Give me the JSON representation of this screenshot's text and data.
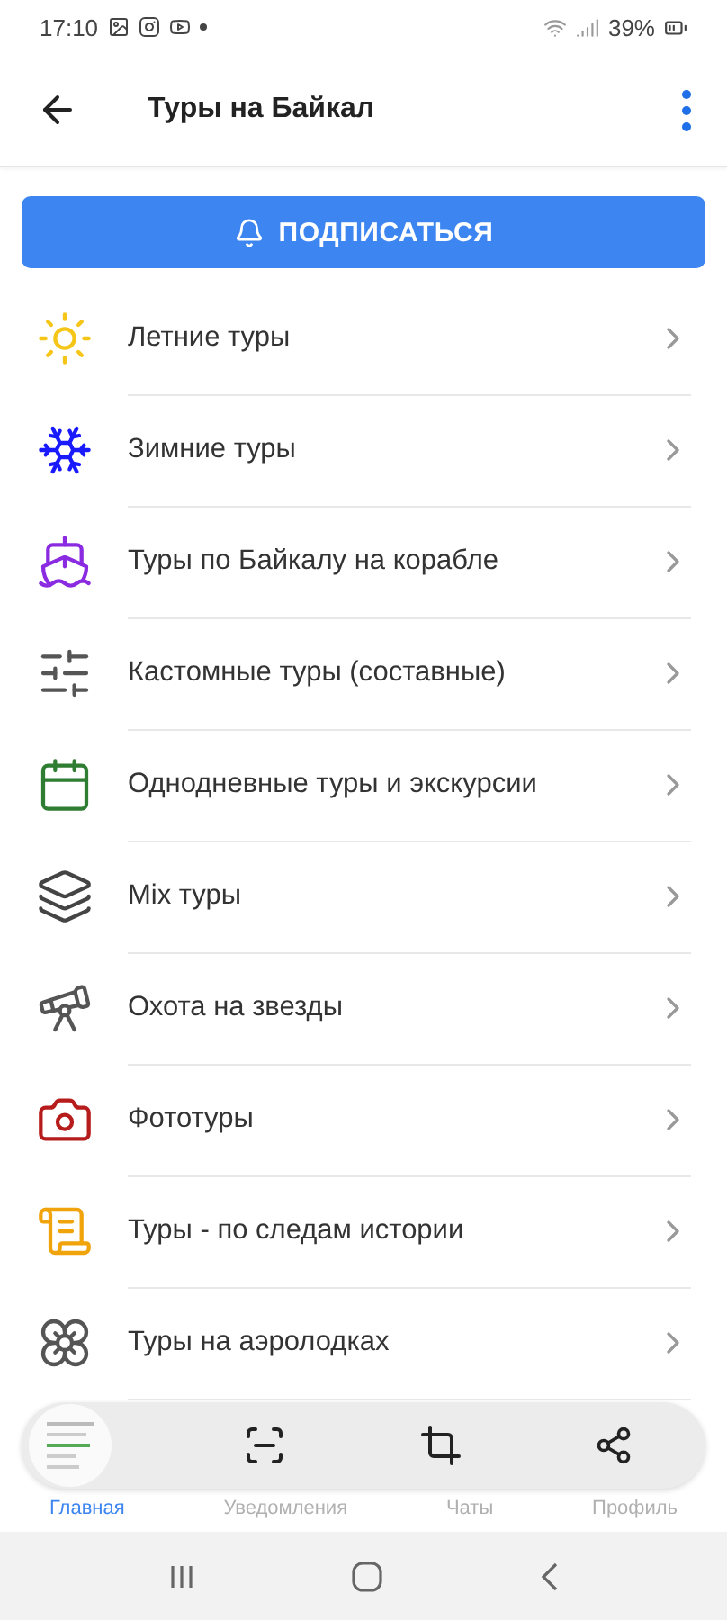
{
  "status_bar": {
    "time": "17:10",
    "battery": "39%"
  },
  "app_bar": {
    "title": "Туры на Байкал"
  },
  "subscribe_button": {
    "label": "ПОДПИСАТЬСЯ"
  },
  "categories": [
    {
      "label": "Летние туры",
      "kind": "sun",
      "color": "#f5c518"
    },
    {
      "label": "Зимние туры",
      "kind": "snowflake",
      "color": "#1a1aff"
    },
    {
      "label": "Туры по Байкалу на корабле",
      "kind": "ship",
      "color": "#8a2be2"
    },
    {
      "label": "Кастомные туры (составные)",
      "kind": "sliders",
      "color": "#555555"
    },
    {
      "label": "Однодневные туры и экскурсии",
      "kind": "calendar",
      "color": "#2e7d32"
    },
    {
      "label": "Mix туры",
      "kind": "layers",
      "color": "#444444"
    },
    {
      "label": "Охота на звезды",
      "kind": "telescope",
      "color": "#555555"
    },
    {
      "label": "Фототуры",
      "kind": "camera",
      "color": "#b71c1c"
    },
    {
      "label": "Туры - по следам истории",
      "kind": "scroll",
      "color": "#f0a30a"
    },
    {
      "label": "Туры на аэролодках",
      "kind": "flower",
      "color": "#555555"
    }
  ],
  "bottom_tabs": [
    {
      "label": "Главная",
      "selected": true
    },
    {
      "label": "Уведомления",
      "selected": false
    },
    {
      "label": "Чаты",
      "selected": false
    },
    {
      "label": "Профиль",
      "selected": false
    }
  ]
}
